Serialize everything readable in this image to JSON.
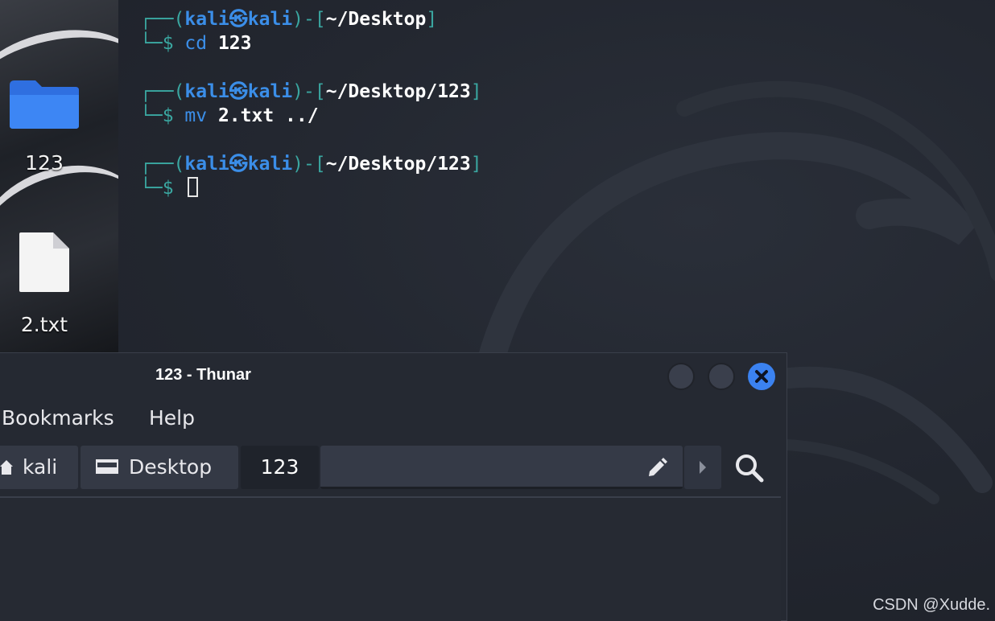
{
  "desktop": {
    "icons": [
      {
        "label": "123",
        "icon": "folder-icon"
      },
      {
        "label": "2.txt",
        "icon": "file-icon"
      }
    ]
  },
  "terminal": {
    "prompts": [
      {
        "open": "┌──(",
        "user": "kali㉿kali",
        "mid": ")-[",
        "path": "~/Desktop",
        "close": "]",
        "prompt": "└─$ ",
        "cmd": "cd",
        "args": " 123"
      },
      {
        "open": "┌──(",
        "user": "kali㉿kali",
        "mid": ")-[",
        "path": "~/Desktop/123",
        "close": "]",
        "prompt": "└─$ ",
        "cmd": "mv",
        "args": " 2.txt ../"
      },
      {
        "open": "┌──(",
        "user": "kali㉿kali",
        "mid": ")-[",
        "path": "~/Desktop/123",
        "close": "]",
        "prompt": "└─$ ",
        "cmd": "",
        "args": ""
      }
    ]
  },
  "thunar": {
    "title": "123 - Thunar",
    "menu": [
      "Bookmarks",
      "Help"
    ],
    "breadcrumbs": [
      {
        "label": "kali",
        "icon": "home-icon"
      },
      {
        "label": "Desktop",
        "icon": "desktop-icon"
      },
      {
        "label": "123",
        "icon": ""
      }
    ]
  },
  "watermark": "CSDN @Xudde."
}
